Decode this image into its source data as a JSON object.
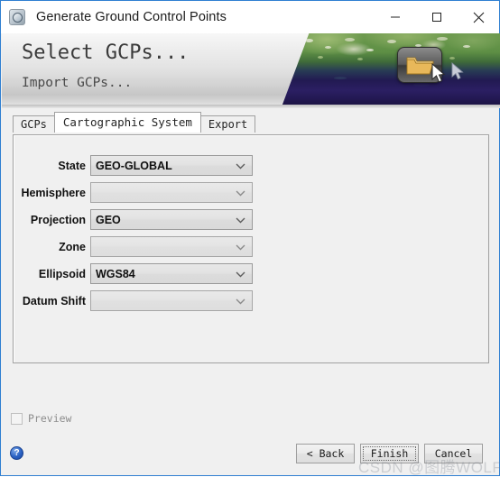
{
  "window": {
    "title": "Generate Ground Control Points",
    "app_icon": "globe-icon",
    "controls": {
      "minimize": "minimize-icon",
      "maximize": "maximize-icon",
      "close": "close-icon"
    }
  },
  "banner": {
    "title": "Select GCPs...",
    "subtitle": "Import GCPs...",
    "image_icon": "folder-open-icon"
  },
  "tabs": [
    {
      "label": "GCPs",
      "active": false
    },
    {
      "label": "Cartographic System",
      "active": true
    },
    {
      "label": "Export",
      "active": false
    }
  ],
  "form": {
    "fields": [
      {
        "label": "State",
        "value": "GEO-GLOBAL",
        "empty": false
      },
      {
        "label": "Hemisphere",
        "value": "",
        "empty": true
      },
      {
        "label": "Projection",
        "value": "GEO",
        "empty": false
      },
      {
        "label": "Zone",
        "value": "",
        "empty": true
      },
      {
        "label": "Ellipsoid",
        "value": "WGS84",
        "empty": false
      },
      {
        "label": "Datum Shift",
        "value": "",
        "empty": true
      }
    ]
  },
  "preview": {
    "label": "Preview",
    "checked": false
  },
  "footer": {
    "help_icon": "help-question-icon",
    "buttons": [
      {
        "label": "< Back",
        "focused": false
      },
      {
        "label": "Finish",
        "focused": true
      },
      {
        "label": "Cancel",
        "focused": false
      }
    ]
  },
  "watermark": {
    "text": "CSDN @图腾WOLF"
  },
  "colors": {
    "window_border": "#2f7fd1",
    "panel_bg": "#f0f0f0",
    "accent_blue": "#2a62c4"
  }
}
